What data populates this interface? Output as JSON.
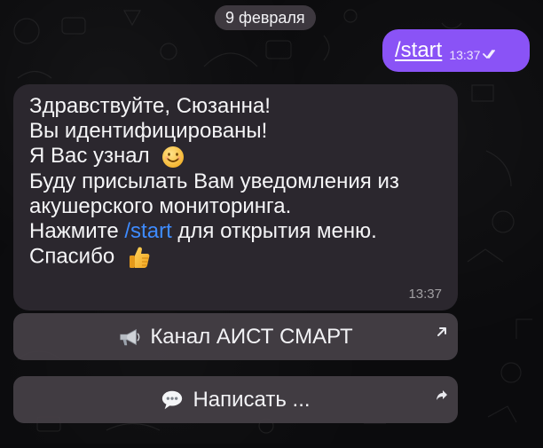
{
  "conversation": {
    "date_separator": "9 февраля",
    "outgoing": {
      "text": "/start",
      "time": "13:37",
      "status_icon": "double-check-icon"
    },
    "incoming": {
      "lines": [
        "Здравствуйте, Сюзанна!",
        "Вы идентифицированы!",
        "Я Вас узнал",
        "Буду присылать Вам уведомления из",
        "акушерского мониторинга."
      ],
      "press_prefix": "Нажмите",
      "command": "/start",
      "press_suffix": "для открытия меню.",
      "thanks": "Спасибо",
      "time": "13:37",
      "emoji_1": "smile-emoji-icon",
      "emoji_2": "thumbs-up-emoji-icon"
    },
    "keyboard": {
      "buttons": [
        {
          "icon": "megaphone-icon",
          "label": "Канал АИСТ СМАРТ",
          "corner_icon": "external-link-arrow-icon"
        },
        {
          "icon": "speech-bubble-icon",
          "label": "Написать ...",
          "corner_icon": "share-arrow-icon"
        }
      ]
    }
  },
  "colors": {
    "background": "#0b0b0d",
    "outgoing_bubble": "#8a53f6",
    "incoming_bubble": "#2c2830",
    "button": "#453f46",
    "link": "#3e8bff",
    "text": "#f5f5f7"
  }
}
